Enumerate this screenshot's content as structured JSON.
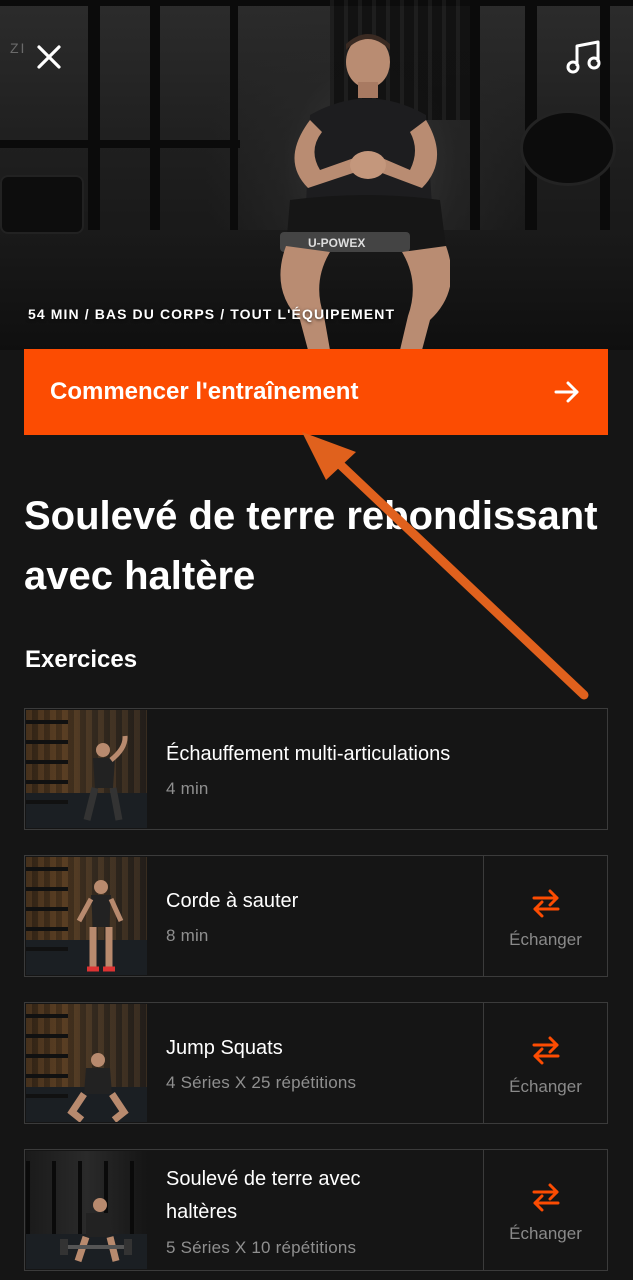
{
  "hero": {
    "meta": "54 MIN / BAS DU CORPS / TOUT L'ÉQUIPEMENT",
    "band_text": "U-POWEX",
    "gym_sign": "ZI"
  },
  "cta": {
    "label": "Commencer l'entraînement"
  },
  "workout": {
    "title": "Soulevé de terre rebondissant avec haltère"
  },
  "exercises_section": {
    "title": "Exercices"
  },
  "exercises": [
    {
      "name": "Échauffement multi-articulations",
      "detail": "4 min",
      "swappable": false
    },
    {
      "name": "Corde à sauter",
      "detail": "8 min",
      "swappable": true,
      "swap_label": "Échanger"
    },
    {
      "name": "Jump Squats",
      "detail": "4 Séries X 25 répétitions",
      "swappable": true,
      "swap_label": "Échanger"
    },
    {
      "name_line1": "Soulevé de terre avec",
      "name_line2": "haltères",
      "detail": "5 Séries X 10 répétitions",
      "swappable": true,
      "swap_label": "Échanger"
    }
  ],
  "colors": {
    "accent": "#fc4c02",
    "background": "#151515",
    "annotation_arrow": "#e0611d"
  },
  "icons": {
    "close": "close-icon",
    "music": "music-note-icon",
    "cta_arrow": "arrow-right-icon",
    "swap": "swap-arrows-icon"
  }
}
